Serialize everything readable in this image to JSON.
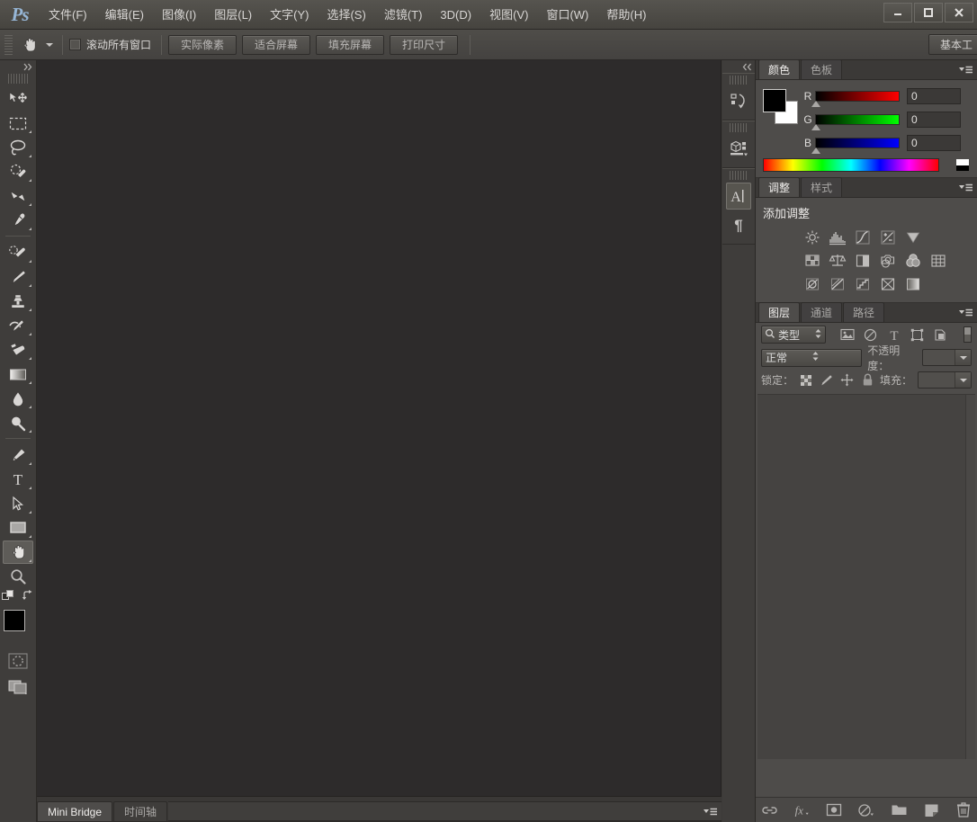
{
  "app": {
    "name": "Ps",
    "logo_text": "Ps"
  },
  "titlebar": {
    "menus": [
      {
        "label": "文件(F)",
        "name": "menu-file"
      },
      {
        "label": "编辑(E)",
        "name": "menu-edit"
      },
      {
        "label": "图像(I)",
        "name": "menu-image"
      },
      {
        "label": "图层(L)",
        "name": "menu-layer"
      },
      {
        "label": "文字(Y)",
        "name": "menu-type"
      },
      {
        "label": "选择(S)",
        "name": "menu-select"
      },
      {
        "label": "滤镜(T)",
        "name": "menu-filter"
      },
      {
        "label": "3D(D)",
        "name": "menu-3d"
      },
      {
        "label": "视图(V)",
        "name": "menu-view"
      },
      {
        "label": "窗口(W)",
        "name": "menu-window"
      },
      {
        "label": "帮助(H)",
        "name": "menu-help"
      }
    ],
    "window_controls": {
      "minimize": "minimize-icon",
      "maximize": "maximize-icon",
      "close": "close-icon"
    }
  },
  "options_bar": {
    "active_tool_icon": "hand-tool-icon",
    "scroll_all_windows": {
      "label": "滚动所有窗口",
      "checked": false
    },
    "buttons": [
      {
        "label": "实际像素",
        "name": "actual-pixels-button"
      },
      {
        "label": "适合屏幕",
        "name": "fit-screen-button"
      },
      {
        "label": "填充屏幕",
        "name": "fill-screen-button"
      },
      {
        "label": "打印尺寸",
        "name": "print-size-button"
      }
    ],
    "workspace": {
      "label": "基本工"
    }
  },
  "toolbar": {
    "collapse_icon": "double-chevron-right-icon",
    "tools": [
      {
        "name": "move-tool",
        "icon": "move-icon",
        "has_flyout": false,
        "active": false
      },
      {
        "name": "marquee-tool",
        "icon": "rectangular-marquee-icon",
        "has_flyout": true,
        "active": false
      },
      {
        "name": "lasso-tool",
        "icon": "lasso-icon",
        "has_flyout": true,
        "active": false
      },
      {
        "name": "quick-selection-tool",
        "icon": "quick-selection-icon",
        "has_flyout": true,
        "active": false
      },
      {
        "name": "crop-tool",
        "icon": "crop-icon",
        "has_flyout": true,
        "active": false
      },
      {
        "name": "eyedropper-tool",
        "icon": "eyedropper-icon",
        "has_flyout": true,
        "active": false
      },
      {
        "name": "healing-brush-tool",
        "icon": "healing-brush-icon",
        "has_flyout": true,
        "active": false
      },
      {
        "name": "brush-tool",
        "icon": "brush-icon",
        "has_flyout": true,
        "active": false
      },
      {
        "name": "clone-stamp-tool",
        "icon": "clone-stamp-icon",
        "has_flyout": true,
        "active": false
      },
      {
        "name": "history-brush-tool",
        "icon": "history-brush-icon",
        "has_flyout": true,
        "active": false
      },
      {
        "name": "eraser-tool",
        "icon": "eraser-icon",
        "has_flyout": true,
        "active": false
      },
      {
        "name": "gradient-tool",
        "icon": "gradient-icon",
        "has_flyout": true,
        "active": false
      },
      {
        "name": "blur-tool",
        "icon": "blur-droplet-icon",
        "has_flyout": true,
        "active": false
      },
      {
        "name": "dodge-tool",
        "icon": "dodge-icon",
        "has_flyout": true,
        "active": false
      },
      {
        "name": "pen-tool",
        "icon": "pen-icon",
        "has_flyout": true,
        "active": false
      },
      {
        "name": "type-tool",
        "icon": "type-t-icon",
        "has_flyout": true,
        "active": false
      },
      {
        "name": "path-selection-tool",
        "icon": "path-arrow-icon",
        "has_flyout": true,
        "active": false
      },
      {
        "name": "shape-tool",
        "icon": "rectangle-shape-icon",
        "has_flyout": true,
        "active": false
      },
      {
        "name": "hand-tool",
        "icon": "hand-icon",
        "has_flyout": true,
        "active": true
      },
      {
        "name": "zoom-tool",
        "icon": "magnifier-icon",
        "has_flyout": false,
        "active": false
      }
    ],
    "color_controls": {
      "default_colors_icon": "default-colors-icon",
      "swap_colors_icon": "swap-colors-icon",
      "foreground": "#000000",
      "background": "#ffffff"
    },
    "quick_mask_icon": "quick-mask-icon",
    "screen_mode_icon": "screen-mode-icon"
  },
  "canvas": {
    "background": "#2d2b2b"
  },
  "bottom_bar": {
    "tabs": [
      {
        "label": "Mini Bridge",
        "name": "tab-mini-bridge",
        "active": true
      },
      {
        "label": "时间轴",
        "name": "tab-timeline",
        "active": false
      }
    ],
    "panel_menu_icon": "panel-menu-icon"
  },
  "dock": {
    "collapse_icon": "double-chevron-left-icon",
    "groups": [
      {
        "name": "dock-group-history",
        "icons": [
          {
            "name": "history-panel-icon",
            "icon": "history-icon",
            "active": false
          }
        ]
      },
      {
        "name": "dock-group-3d",
        "icons": [
          {
            "name": "3d-panel-icon",
            "icon": "cube-3d-icon",
            "active": false
          }
        ]
      },
      {
        "name": "dock-group-type",
        "icons": [
          {
            "name": "character-panel-icon",
            "icon": "character-a-icon",
            "active": true
          },
          {
            "name": "paragraph-panel-icon",
            "icon": "paragraph-pilcrow-icon",
            "active": false
          }
        ]
      }
    ]
  },
  "color_panel": {
    "tabs": [
      {
        "label": "颜色",
        "name": "tab-color",
        "active": true
      },
      {
        "label": "色板",
        "name": "tab-swatches",
        "active": false
      }
    ],
    "panel_menu_icon": "panel-menu-icon",
    "foreground_color": "#000000",
    "background_color": "#ffffff",
    "channels": [
      {
        "label": "R",
        "value": "0",
        "name": "red-channel"
      },
      {
        "label": "G",
        "value": "0",
        "name": "green-channel"
      },
      {
        "label": "B",
        "value": "0",
        "name": "blue-channel"
      }
    ]
  },
  "adjustments_panel": {
    "tabs": [
      {
        "label": "调整",
        "name": "tab-adjustments",
        "active": true
      },
      {
        "label": "样式",
        "name": "tab-styles",
        "active": false
      }
    ],
    "panel_menu_icon": "panel-menu-icon",
    "title": "添加调整",
    "rows": [
      [
        {
          "name": "brightness-contrast-adjustment",
          "icon": "brightness-sun-icon"
        },
        {
          "name": "levels-adjustment",
          "icon": "levels-histogram-icon"
        },
        {
          "name": "curves-adjustment",
          "icon": "curves-icon"
        },
        {
          "name": "exposure-adjustment",
          "icon": "exposure-plusminus-icon"
        },
        {
          "name": "vibrance-adjustment",
          "icon": "vibrance-triangle-icon"
        }
      ],
      [
        {
          "name": "hue-saturation-adjustment",
          "icon": "hue-saturation-icon"
        },
        {
          "name": "color-balance-adjustment",
          "icon": "color-balance-scale-icon"
        },
        {
          "name": "black-white-adjustment",
          "icon": "black-white-icon"
        },
        {
          "name": "photo-filter-adjustment",
          "icon": "photo-filter-camera-icon"
        },
        {
          "name": "channel-mixer-adjustment",
          "icon": "channel-mixer-venn-icon"
        },
        {
          "name": "color-lookup-adjustment",
          "icon": "color-lookup-grid-icon"
        }
      ],
      [
        {
          "name": "invert-adjustment",
          "icon": "invert-circle-icon"
        },
        {
          "name": "posterize-adjustment",
          "icon": "posterize-icon"
        },
        {
          "name": "threshold-adjustment",
          "icon": "threshold-steps-icon"
        },
        {
          "name": "selective-color-adjustment",
          "icon": "selective-color-icon"
        },
        {
          "name": "gradient-map-adjustment",
          "icon": "gradient-map-icon"
        }
      ]
    ]
  },
  "layers_panel": {
    "tabs": [
      {
        "label": "图层",
        "name": "tab-layers",
        "active": true
      },
      {
        "label": "通道",
        "name": "tab-channels",
        "active": false
      },
      {
        "label": "路径",
        "name": "tab-paths",
        "active": false
      }
    ],
    "panel_menu_icon": "panel-menu-icon",
    "filter": {
      "search_icon": "search-icon",
      "type_label": "类型",
      "filter_icons": [
        {
          "name": "filter-pixel-layers",
          "icon": "image-icon"
        },
        {
          "name": "filter-adjustment-layers",
          "icon": "adjustment-circle-icon"
        },
        {
          "name": "filter-type-layers",
          "icon": "type-t-icon"
        },
        {
          "name": "filter-shape-layers",
          "icon": "shape-bounds-icon"
        },
        {
          "name": "filter-smart-objects",
          "icon": "smart-object-icon"
        }
      ],
      "toggle_name": "filter-enable-toggle"
    },
    "blend_mode": "正常",
    "opacity": {
      "label": "不透明度：",
      "value": ""
    },
    "lock": {
      "label": "锁定：",
      "icons": [
        {
          "name": "lock-transparent-pixels",
          "icon": "checkerboard-icon"
        },
        {
          "name": "lock-image-pixels",
          "icon": "brush-icon"
        },
        {
          "name": "lock-position",
          "icon": "move-arrows-icon"
        },
        {
          "name": "lock-all",
          "icon": "lock-icon"
        }
      ]
    },
    "fill": {
      "label": "填充：",
      "value": ""
    },
    "layers": [],
    "bottom_buttons": [
      {
        "name": "link-layers-button",
        "icon": "link-icon"
      },
      {
        "name": "layer-style-button",
        "icon": "fx-icon"
      },
      {
        "name": "add-layer-mask-button",
        "icon": "mask-icon"
      },
      {
        "name": "new-fill-adjustment-button",
        "icon": "adjustment-circle-icon"
      },
      {
        "name": "new-group-button",
        "icon": "folder-icon"
      },
      {
        "name": "new-layer-button",
        "icon": "new-layer-icon"
      },
      {
        "name": "delete-layer-button",
        "icon": "trash-icon"
      }
    ]
  }
}
